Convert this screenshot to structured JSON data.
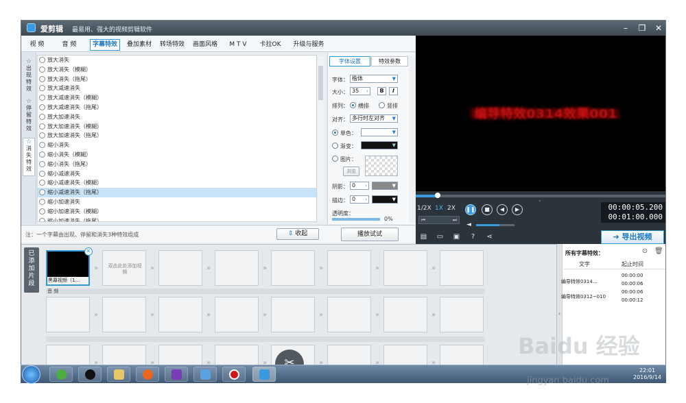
{
  "window": {
    "title": "爱剪辑",
    "slogan": "最易用、强大的视频剪辑软件"
  },
  "tabs": [
    "视 频",
    "音 频",
    "字幕特效",
    "叠加素材",
    "转场特效",
    "画面风格",
    "M T V",
    "卡拉OK",
    "升级与服务"
  ],
  "active_tab": "字幕特效",
  "side_tabs": [
    {
      "label": "出现特效",
      "icon": "star-icon"
    },
    {
      "label": "停留特效",
      "icon": "star-icon"
    },
    {
      "label": "消失特效",
      "icon": "star-icon"
    }
  ],
  "effects": [
    "放大消失",
    "放大消失（模糊）",
    "放大消失（拖尾）",
    "放大减速消失",
    "放大减速消失（模糊）",
    "放大减速消失（拖尾）",
    "放大加速消失",
    "放大加速消失（模糊）",
    "放大加速消失（拖尾）",
    "缩小消失",
    "缩小消失（模糊）",
    "缩小消失（拖尾）",
    "缩小减速消失",
    "缩小减速消失（模糊）",
    "缩小减速消失（拖尾）",
    "缩小加速消失",
    "缩小加速消失（模糊）",
    "缩小加速消失（拖尾）"
  ],
  "selected_effect": "缩小减速消失（拖尾）",
  "tip": "注：一个字幕由出现、停留和消失3种特效组成",
  "collapse_label": "收起",
  "play_test_label": "播放试试",
  "props": {
    "tabs": [
      "字体设置",
      "特效参数"
    ],
    "font_label": "字体：",
    "font_value": "楷体",
    "size_label": "大小：",
    "size_value": "35",
    "bold": "B",
    "italic": "I",
    "layout_label": "排列：",
    "layout_h": "横排",
    "layout_v": "竖排",
    "align_label": "对齐：",
    "align_value": "多行时左对齐",
    "mono_label": "单色：",
    "gradient_label": "渐变：",
    "image_label": "图片：",
    "browse_label": "浏览",
    "shadow_label": "阴影：",
    "shadow_value": "0",
    "stroke_label": "描边：",
    "stroke_value": "0",
    "opacity_label": "透明度：",
    "opacity_value": "0%"
  },
  "preview": {
    "caption": "编导特效0314效果001"
  },
  "player": {
    "speeds": [
      "1/2X",
      "1X",
      "2X"
    ],
    "active_speed": "1X",
    "current_time": "00:00:05.200",
    "total_time": "00:01:00.000",
    "progress": 0.087,
    "volume": 0.6
  },
  "export_label": "导出视频",
  "timeline": {
    "added_label": "已添加片段",
    "audio_label": "音 频",
    "clip_name": "黑幕视频（1…",
    "add_placeholder": "双击此处添加视频"
  },
  "subtitles": {
    "title": "所有字幕特效：",
    "col_text": "文字",
    "col_time": "起止时间",
    "rows": [
      {
        "text": "编导特效0314…",
        "start": "00:00:00",
        "end": "00:00:06"
      },
      {
        "text": "编导特效0312~010",
        "start": "00:00:06",
        "end": "00:00:12"
      }
    ]
  },
  "taskbar": {
    "time": "22:01",
    "date": "2016/9/14"
  },
  "watermark": {
    "brand": "Baidu 经验",
    "url": "jingyan.baidu.com"
  }
}
